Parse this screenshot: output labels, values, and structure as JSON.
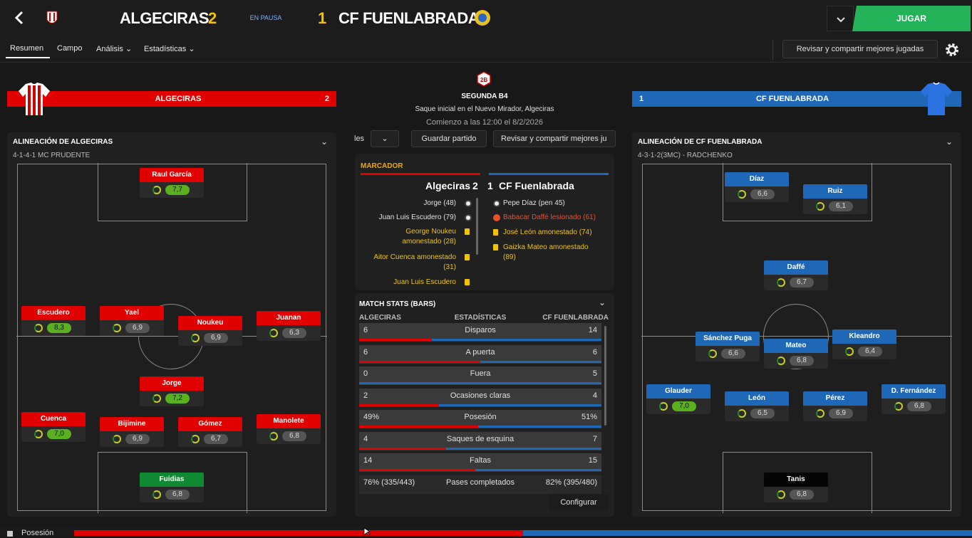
{
  "header": {
    "home_team": "ALGECIRAS",
    "home_score": "2",
    "status": "EN PAUSA",
    "away_score": "1",
    "away_team": "CF FUENLABRADA",
    "play_button": "JUGAR"
  },
  "nav": {
    "tabs": [
      "Resumen",
      "Campo",
      "Análisis",
      "Estadísticas"
    ],
    "share_button": "Revisar y compartir mejores jugadas"
  },
  "home_banner": {
    "team": "ALGECIRAS",
    "score": "2"
  },
  "away_banner": {
    "team": "CF FUENLABRADA",
    "score": "1"
  },
  "match_info": {
    "competition": "SEGUNDA B4",
    "venue": "Saque inicial en el Nuevo Mirador, Algeciras",
    "time": "Comienzo a las 12:00 el 8/2/2026",
    "tab_partial": "les",
    "save_button": "Guardar partido",
    "share_partial": "Revisar y compartir mejores ju"
  },
  "home_lineup": {
    "title": "ALINEACIÓN DE ALGECIRAS",
    "formation": "4-1-4-1 MC PRUDENTE",
    "players": [
      {
        "name": "Raul García",
        "rating": "7,7",
        "hi": true,
        "color": "red"
      },
      {
        "name": "Escudero",
        "rating": "8,3",
        "hi": true,
        "color": "red"
      },
      {
        "name": "Yael",
        "rating": "6,9",
        "hi": false,
        "color": "red"
      },
      {
        "name": "Noukeu",
        "rating": "6,9",
        "hi": false,
        "color": "red"
      },
      {
        "name": "Juanan",
        "rating": "6,3",
        "hi": false,
        "color": "red"
      },
      {
        "name": "Jorge",
        "rating": "7,2",
        "hi": true,
        "color": "red"
      },
      {
        "name": "Cuenca",
        "rating": "7,0",
        "hi": true,
        "color": "red"
      },
      {
        "name": "Bijimine",
        "rating": "6,9",
        "hi": false,
        "color": "red"
      },
      {
        "name": "Gómez",
        "rating": "6,7",
        "hi": false,
        "color": "red"
      },
      {
        "name": "Manolete",
        "rating": "6,8",
        "hi": false,
        "color": "red"
      },
      {
        "name": "Fuidias",
        "rating": "6,8",
        "hi": false,
        "color": "green"
      }
    ]
  },
  "away_lineup": {
    "title": "ALINEACIÓN DE CF FUENLABRADA",
    "formation": "4-3-1-2(3MC) - RADCHENKO",
    "players": [
      {
        "name": "Díaz",
        "rating": "6,6",
        "hi": false,
        "color": "blue"
      },
      {
        "name": "Ruiz",
        "rating": "6,1",
        "hi": false,
        "color": "blue"
      },
      {
        "name": "Daffé",
        "rating": "6,7",
        "hi": false,
        "color": "blue"
      },
      {
        "name": "Sánchez Puga",
        "rating": "6,6",
        "hi": false,
        "color": "blue"
      },
      {
        "name": "Mateo",
        "rating": "6,8",
        "hi": false,
        "color": "blue"
      },
      {
        "name": "Kleandro",
        "rating": "6,4",
        "hi": false,
        "color": "blue"
      },
      {
        "name": "Glauder",
        "rating": "7,0",
        "hi": true,
        "color": "blue"
      },
      {
        "name": "León",
        "rating": "6,5",
        "hi": false,
        "color": "blue"
      },
      {
        "name": "Pérez",
        "rating": "6,9",
        "hi": false,
        "color": "blue"
      },
      {
        "name": "D. Fernández",
        "rating": "6,8",
        "hi": false,
        "color": "blue"
      },
      {
        "name": "Tanis",
        "rating": "6,8",
        "hi": false,
        "color": "black"
      }
    ]
  },
  "scoreboard": {
    "label": "MARCADOR",
    "home": "Algeciras",
    "home_score": "2",
    "away_score": "1",
    "away": "CF Fuenlabrada",
    "home_events": [
      {
        "text": "Jorge (48)",
        "type": "goal"
      },
      {
        "text": "Juan Luis Escudero (79)",
        "type": "goal"
      },
      {
        "text": "George Noukeu",
        "type": "yellow"
      },
      {
        "text": "amonestado (28)",
        "type": "yellow"
      },
      {
        "text": "Aitor Cuenca amonestado",
        "type": "yellow"
      },
      {
        "text": "(31)",
        "type": "yellow"
      },
      {
        "text": "Juan Luis Escudero",
        "type": "yellow"
      }
    ],
    "away_events": [
      {
        "text": "Pepe Díaz (pen 45)",
        "type": "goal"
      },
      {
        "text": "Babacar Daffé lesionado (61)",
        "type": "injury"
      },
      {
        "text": "José León amonestado (74)",
        "type": "yellow"
      },
      {
        "text": "Gaizka Mateo amonestado",
        "type": "yellow"
      },
      {
        "text": "(89)",
        "type": "yellow"
      }
    ]
  },
  "match_stats": {
    "title": "MATCH STATS (BARS)",
    "home_header": "ALGECIRAS",
    "mid_header": "ESTADÍSTICAS",
    "away_header": "CF FUENLABRADA",
    "rows": [
      {
        "home": "6",
        "label": "Disparos",
        "away": "14",
        "home_frac": 0.3
      },
      {
        "home": "6",
        "label": "A puerta",
        "away": "6",
        "home_frac": 0.5
      },
      {
        "home": "0",
        "label": "Fuera",
        "away": "5",
        "home_frac": 0.0
      },
      {
        "home": "2",
        "label": "Ocasiones claras",
        "away": "4",
        "home_frac": 0.33
      },
      {
        "home": "49%",
        "label": "Posesión",
        "away": "51%",
        "home_frac": 0.49
      },
      {
        "home": "4",
        "label": "Saques de esquina",
        "away": "7",
        "home_frac": 0.36
      },
      {
        "home": "14",
        "label": "Faltas",
        "away": "15",
        "home_frac": 0.48
      },
      {
        "home": "76% (335/443)",
        "label": "Pases completados",
        "away": "82% (395/480)",
        "home_frac": null
      }
    ],
    "configure_button": "Configurar"
  },
  "footer": {
    "possession_label": "Posesión",
    "home_possession": 0.5
  },
  "colors": {
    "home": "#e10000",
    "away": "#1f68b8",
    "play": "#25b35a"
  }
}
